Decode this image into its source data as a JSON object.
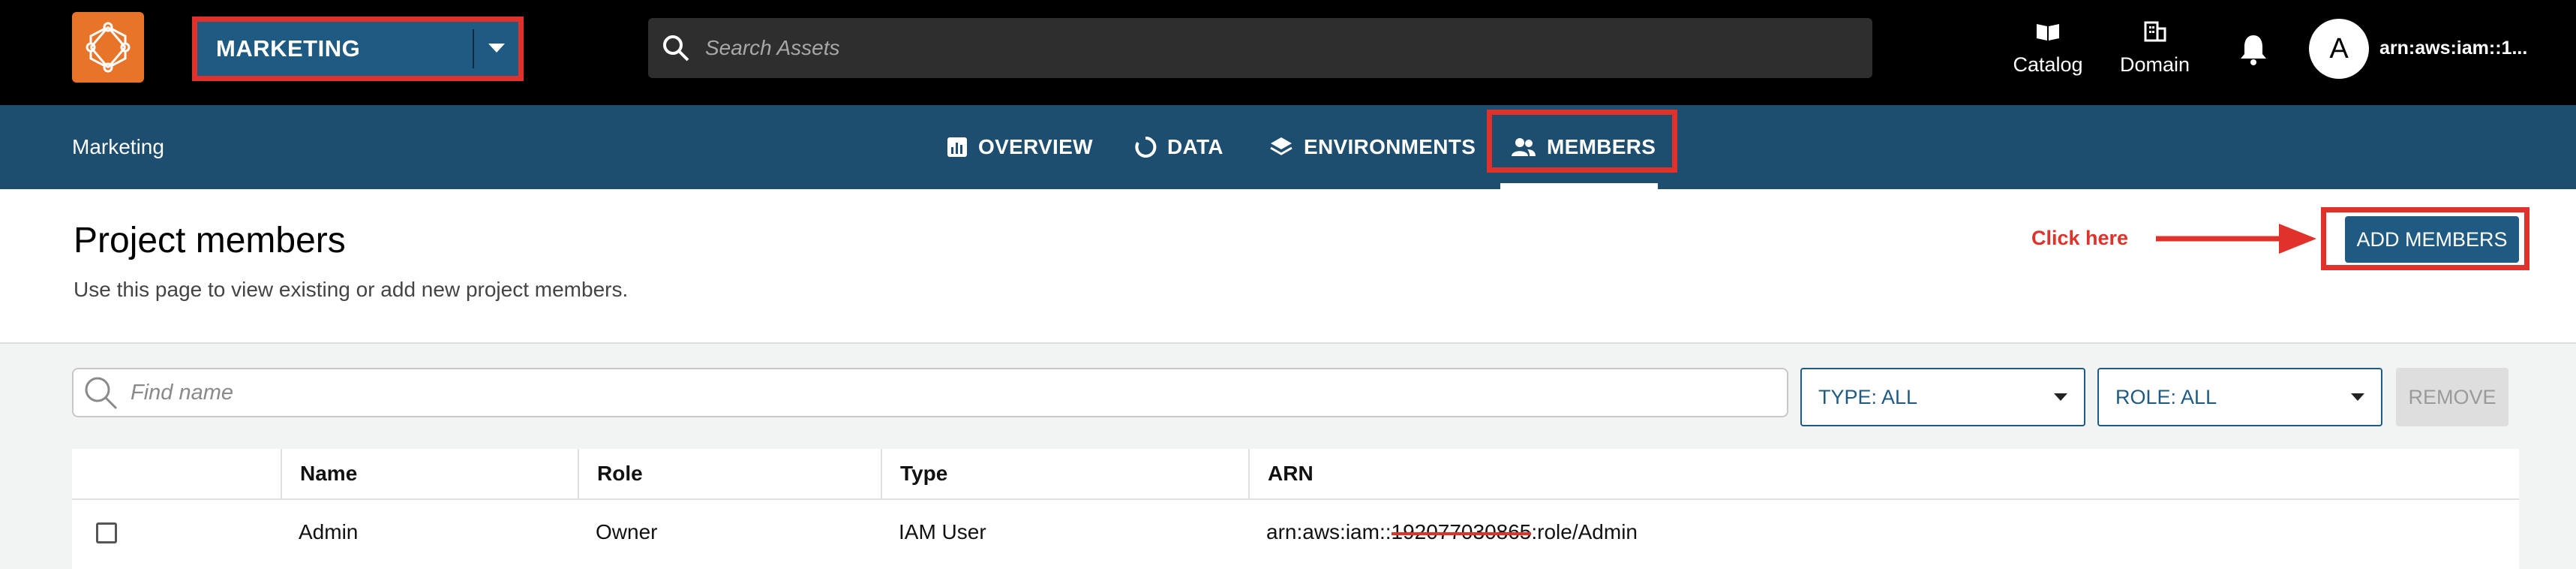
{
  "topbar": {
    "project": "MARKETING",
    "search_placeholder": "Search Assets",
    "catalog": "Catalog",
    "domain": "Domain",
    "avatar_initial": "A",
    "user_arn": "arn:aws:iam::1..."
  },
  "subnav": {
    "breadcrumb": "Marketing",
    "tabs": [
      {
        "label": "OVERVIEW",
        "icon": "bar-chart-icon"
      },
      {
        "label": "DATA",
        "icon": "circle-icon"
      },
      {
        "label": "ENVIRONMENTS",
        "icon": "layers-icon"
      },
      {
        "label": "MEMBERS",
        "icon": "people-icon"
      }
    ],
    "active_tab": "MEMBERS"
  },
  "header": {
    "title": "Project members",
    "description": "Use this page to view existing or add new project members.",
    "annotation": "Click here",
    "add_button": "ADD MEMBERS"
  },
  "filters": {
    "find_placeholder": "Find name",
    "type": "TYPE: ALL",
    "role": "ROLE: ALL",
    "remove": "REMOVE"
  },
  "table": {
    "columns": [
      "Name",
      "Role",
      "Type",
      "ARN"
    ],
    "rows": [
      {
        "name": "Admin",
        "role": "Owner",
        "type": "IAM User",
        "arn_prefix": "arn:aws:iam::",
        "arn_redacted": "192077030865",
        "arn_suffix": ":role/Admin"
      }
    ]
  },
  "colors": {
    "accent": "#1f5a83",
    "subnav": "#1d4e6f",
    "annotation_red": "#e0322a",
    "logo": "#e8742a"
  }
}
